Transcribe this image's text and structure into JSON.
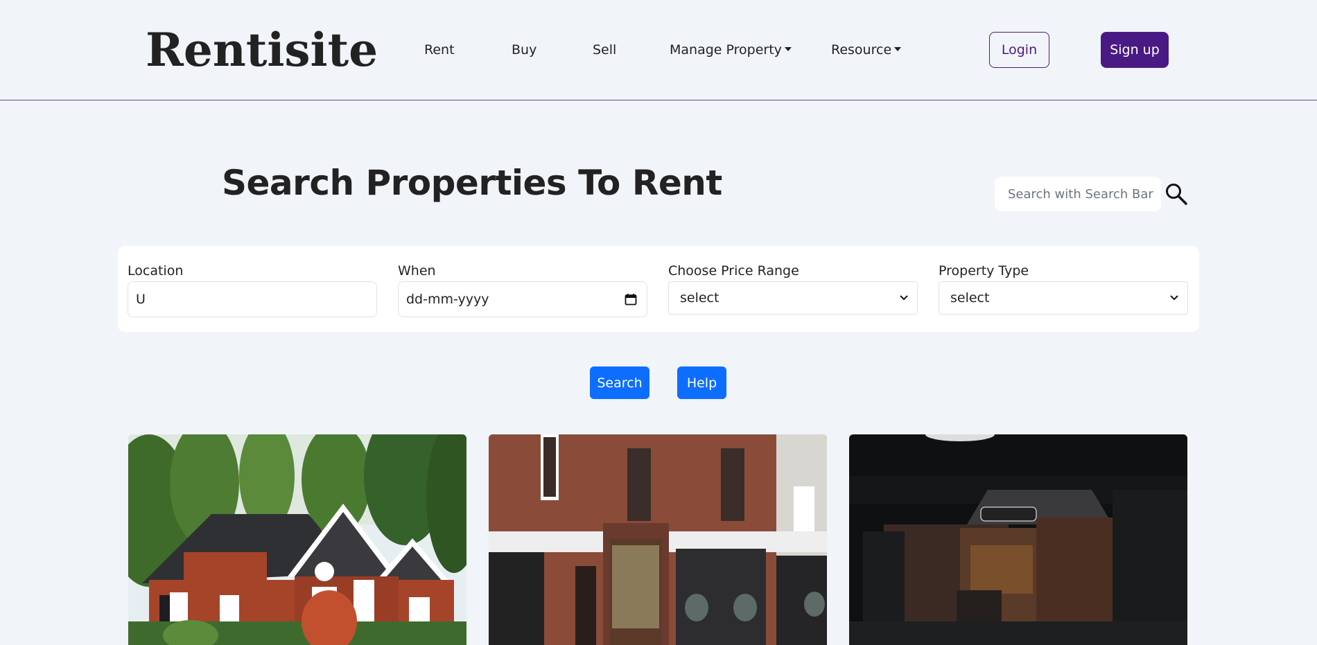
{
  "header": {
    "logo": "Rentisite",
    "nav": {
      "rent": "Rent",
      "buy": "Buy",
      "sell": "Sell",
      "manage_property": "Manage Property",
      "resource": "Resource"
    },
    "login_label": "Login",
    "signup_label": "Sign up"
  },
  "main": {
    "title": "Search Properties To Rent",
    "search": {
      "placeholder": "Search with Search Bar",
      "icon": "search-icon"
    }
  },
  "filters": {
    "location": {
      "label": "Location",
      "value": "U"
    },
    "when": {
      "label": "When",
      "placeholder": "dd-mm-yyyy",
      "icon": "calendar-icon"
    },
    "price": {
      "label": "Choose Price Range",
      "selected": "select"
    },
    "property_type": {
      "label": "Property Type",
      "selected": "select"
    }
  },
  "actions": {
    "search_label": "Search",
    "help_label": "Help"
  },
  "colors": {
    "brand": "#4a1a84",
    "primary": "#0d6efd",
    "background": "#f1f4f9"
  },
  "cards": [
    {
      "image": "brick-suburban-house"
    },
    {
      "image": "brick-storefront-street"
    },
    {
      "image": "dark-restaurant-interior"
    }
  ]
}
